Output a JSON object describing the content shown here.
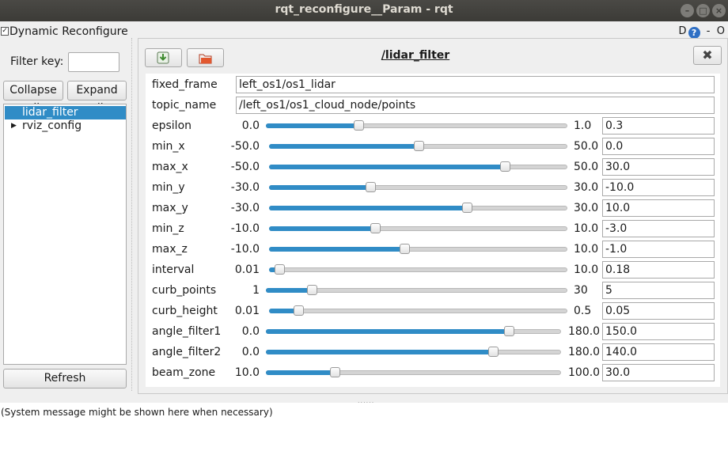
{
  "window": {
    "title": "rqt_reconfigure__Param - rqt"
  },
  "dock": {
    "title": "Dynamic Reconfigure",
    "right_d": "D",
    "right_help": "?",
    "right_dash": "-",
    "right_o": "O"
  },
  "sidebar": {
    "filter_label": "Filter key:",
    "filter_value": "",
    "collapse_label": "Collapse all",
    "expand_label": "Expand all",
    "tree": [
      {
        "label": "lidar_filter",
        "selected": true
      },
      {
        "label": "rviz_config",
        "selected": false
      }
    ],
    "refresh_label": "Refresh"
  },
  "panel": {
    "node_title": "/lidar_filter",
    "close_symbol": "✖",
    "save_icon": "save-icon",
    "load_icon": "folder-open-icon",
    "text_params": [
      {
        "label": "fixed_frame",
        "value": "left_os1/os1_lidar"
      },
      {
        "label": "topic_name",
        "value": "/left_os1/os1_cloud_node/points"
      }
    ],
    "sliders": [
      {
        "label": "epsilon",
        "min": "0.0",
        "max": "1.0",
        "value": "0.3",
        "fraction": 0.3
      },
      {
        "label": "min_x",
        "min": "-50.0",
        "max": "50.0",
        "value": "0.0",
        "fraction": 0.5
      },
      {
        "label": "max_x",
        "min": "-50.0",
        "max": "50.0",
        "value": "30.0",
        "fraction": 0.8
      },
      {
        "label": "min_y",
        "min": "-30.0",
        "max": "30.0",
        "value": "-10.0",
        "fraction": 0.3333
      },
      {
        "label": "max_y",
        "min": "-30.0",
        "max": "30.0",
        "value": "10.0",
        "fraction": 0.6667
      },
      {
        "label": "min_z",
        "min": "-10.0",
        "max": "10.0",
        "value": "-3.0",
        "fraction": 0.35
      },
      {
        "label": "max_z",
        "min": "-10.0",
        "max": "10.0",
        "value": "-1.0",
        "fraction": 0.45
      },
      {
        "label": "interval",
        "min": "0.01",
        "max": "10.0",
        "value": "0.18",
        "fraction": 0.017
      },
      {
        "label": "curb_points",
        "min": "1",
        "max": "30",
        "value": "5",
        "fraction": 0.138
      },
      {
        "label": "curb_height",
        "min": "0.01",
        "max": "0.5",
        "value": "0.05",
        "fraction": 0.082
      },
      {
        "label": "angle_filter1",
        "min": "0.0",
        "max": "180.0",
        "value": "150.0",
        "fraction": 0.8333
      },
      {
        "label": "angle_filter2",
        "min": "0.0",
        "max": "180.0",
        "value": "140.0",
        "fraction": 0.7778
      },
      {
        "label": "beam_zone",
        "min": "10.0",
        "max": "100.0",
        "value": "30.0",
        "fraction": 0.2222
      }
    ]
  },
  "status": {
    "message": "(System message might be shown here when necessary)"
  },
  "colors": {
    "accent": "#308cc6",
    "titlebar": "#3c3b37"
  }
}
